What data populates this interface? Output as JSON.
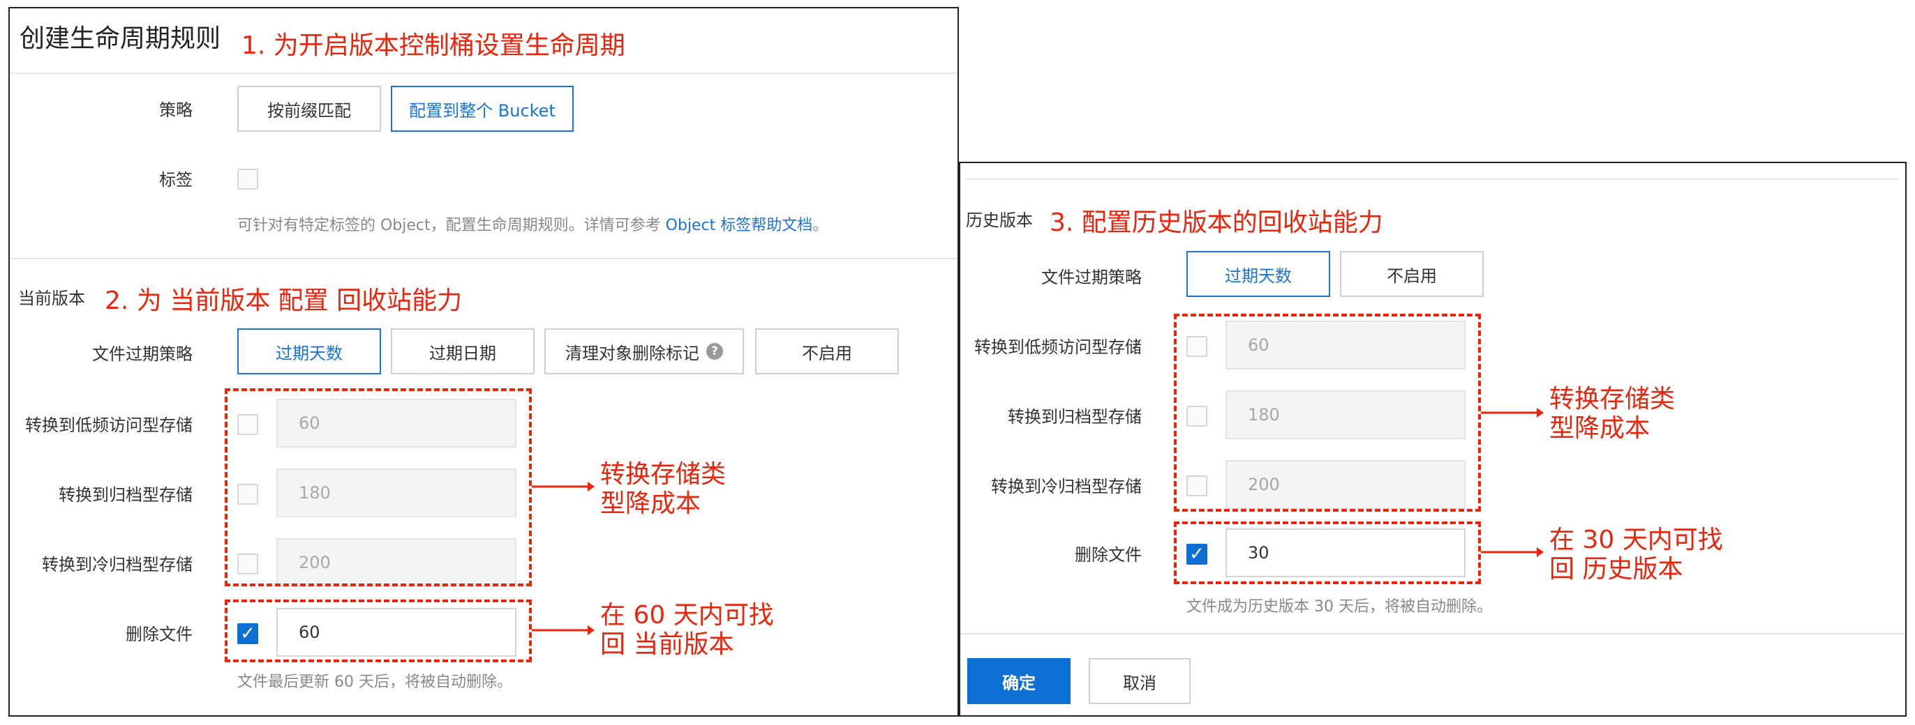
{
  "left": {
    "title": "创建生命周期规则",
    "annotation_1": "1. 为开启版本控制桶设置生命周期",
    "strategy_label": "策略",
    "strategy_buttons": [
      "按前缀匹配",
      "配置到整个 Bucket"
    ],
    "tag_label": "标签",
    "tag_help_prefix": "可针对有特定标签的 Object，配置生命周期规则。详情可参考",
    "tag_help_link": "Object 标签帮助文档",
    "tag_help_suffix": "。",
    "section_label": "当前版本",
    "annotation_2": "2. 为 当前版本 配置 回收站能力",
    "expire_label": "文件过期策略",
    "expire_buttons": [
      "过期天数",
      "过期日期",
      "清理对象删除标记",
      "不启用"
    ],
    "rows": [
      {
        "label": "转换到低频访问型存储",
        "value": "60"
      },
      {
        "label": "转换到归档型存储",
        "value": "180"
      },
      {
        "label": "转换到冷归档型存储",
        "value": "200"
      }
    ],
    "delete_label": "删除文件",
    "delete_value": "60",
    "delete_help": "文件最后更新 60 天后，将被自动删除。",
    "annotation_convert": [
      "转换存储类",
      "型降成本"
    ],
    "annotation_delete": [
      "在 60 天内可找",
      "回 当前版本"
    ]
  },
  "right": {
    "section_label": "历史版本",
    "annotation_3": "3. 配置历史版本的回收站能力",
    "expire_label": "文件过期策略",
    "expire_buttons": [
      "过期天数",
      "不启用"
    ],
    "rows": [
      {
        "label": "转换到低频访问型存储",
        "value": "60"
      },
      {
        "label": "转换到归档型存储",
        "value": "180"
      },
      {
        "label": "转换到冷归档型存储",
        "value": "200"
      }
    ],
    "delete_label": "删除文件",
    "delete_value": "30",
    "delete_help": "文件成为历史版本 30 天后，将被自动删除。",
    "annotation_convert": [
      "转换存储类",
      "型降成本"
    ],
    "annotation_delete": [
      "在 30 天内可找",
      "回 历史版本"
    ],
    "confirm": "确定",
    "cancel": "取消"
  },
  "colors": {
    "annotation": "#e8260e",
    "accent": "#1a74d8",
    "primary": "#0d6fd1"
  }
}
